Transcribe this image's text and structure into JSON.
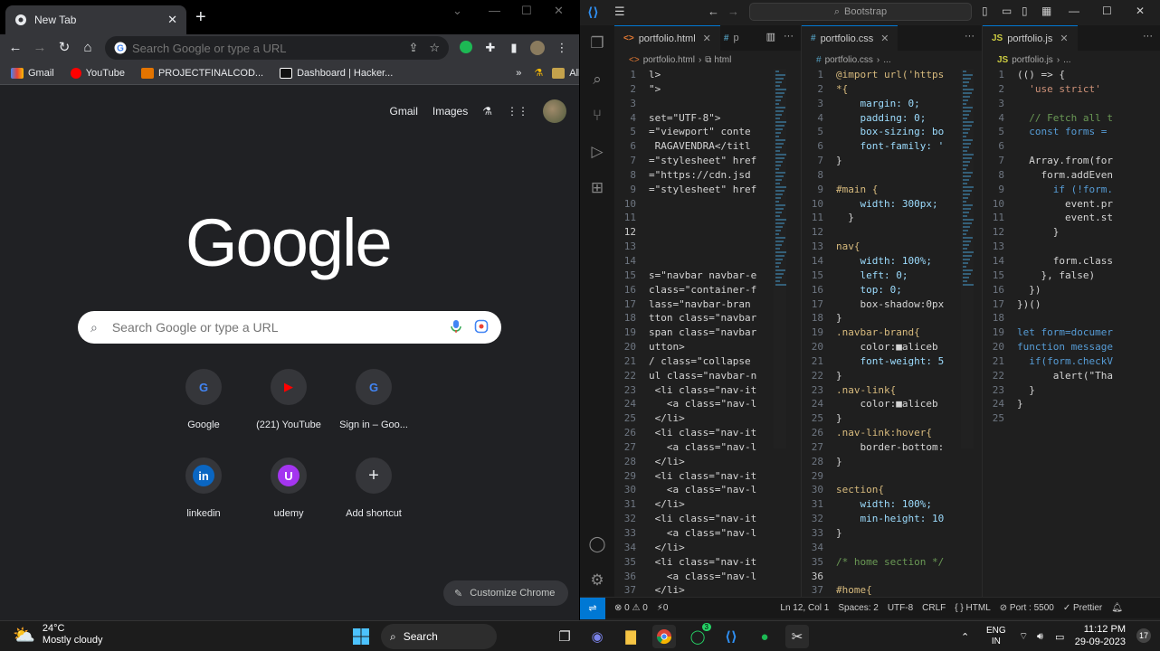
{
  "chrome": {
    "tab_title": "New Tab",
    "omnibox_placeholder": "Search Google or type a URL",
    "bookmarks": [
      {
        "label": "Gmail",
        "color": "#ea4335"
      },
      {
        "label": "YouTube",
        "color": "#ff0000"
      },
      {
        "label": "PROJECTFINALCOD...",
        "color": "#e37400"
      },
      {
        "label": "Dashboard | Hacker...",
        "color": "#ffffff"
      }
    ],
    "all_bookmarks": "All Bookmarks",
    "overflow": "»",
    "ntp": {
      "gmail": "Gmail",
      "images": "Images",
      "logo": "Google",
      "search_placeholder": "Search Google or type a URL",
      "customize": "Customize Chrome",
      "shortcuts": [
        {
          "label": "Google",
          "glyph": "G",
          "color": "#4285f4"
        },
        {
          "label": "(221) YouTube",
          "glyph": "▶",
          "color": "#ff0000"
        },
        {
          "label": "Sign in – Goo...",
          "glyph": "G",
          "color": "#4285f4"
        },
        {
          "label": "linkedin",
          "glyph": "in",
          "color": "#0a66c2"
        },
        {
          "label": "udemy",
          "glyph": "U",
          "color": "#a435f0"
        },
        {
          "label": "Add shortcut",
          "glyph": "+",
          "color": "#e8eaed"
        }
      ]
    }
  },
  "vscode": {
    "command_center": "Bootstrap",
    "groups": [
      {
        "tab": "portfolio.html",
        "tab_icon": "<>",
        "extra_tab": "p",
        "breadcrumb": [
          "portfolio.html",
          "html"
        ],
        "lines": [
          [
            "1",
            "l>"
          ],
          [
            "2",
            "\">"
          ],
          [
            "3",
            ""
          ],
          [
            "4",
            "set=\"UTF-8\">"
          ],
          [
            "5",
            "=\"viewport\" conte"
          ],
          [
            "6",
            " RAGAVENDRA</titl"
          ],
          [
            "7",
            "=\"stylesheet\" href"
          ],
          [
            "8",
            "=\"https://cdn.jsd"
          ],
          [
            "9",
            "=\"stylesheet\" href"
          ],
          [
            "10",
            ""
          ],
          [
            "11",
            ""
          ],
          [
            "12",
            ""
          ],
          [
            "13",
            ""
          ],
          [
            "14",
            ""
          ],
          [
            "15",
            "s=\"navbar navbar-e"
          ],
          [
            "16",
            "class=\"container-f"
          ],
          [
            "17",
            "lass=\"navbar-bran"
          ],
          [
            "18",
            "tton class=\"navbar"
          ],
          [
            "19",
            "span class=\"navbar"
          ],
          [
            "20",
            "utton>"
          ],
          [
            "21",
            "/ class=\"collapse"
          ],
          [
            "22",
            "ul class=\"navbar-n"
          ],
          [
            "23",
            " <li class=\"nav-it"
          ],
          [
            "24",
            "   <a class=\"nav-l"
          ],
          [
            "25",
            " </li>"
          ],
          [
            "26",
            " <li class=\"nav-it"
          ],
          [
            "27",
            "   <a class=\"nav-l"
          ],
          [
            "28",
            " </li>"
          ],
          [
            "29",
            " <li class=\"nav-it"
          ],
          [
            "30",
            "   <a class=\"nav-l"
          ],
          [
            "31",
            " </li>"
          ],
          [
            "32",
            " <li class=\"nav-it"
          ],
          [
            "33",
            "   <a class=\"nav-l"
          ],
          [
            "34",
            " </li>"
          ],
          [
            "35",
            " <li class=\"nav-it"
          ],
          [
            "36",
            "   <a class=\"nav-l"
          ],
          [
            "37",
            " </li>"
          ]
        ]
      },
      {
        "tab": "portfolio.css",
        "tab_icon": "#",
        "breadcrumb": [
          "portfolio.css",
          "..."
        ],
        "lines": [
          [
            "1",
            "@import url('https"
          ],
          [
            "2",
            "*{"
          ],
          [
            "3",
            "    margin: 0;"
          ],
          [
            "4",
            "    padding: 0;"
          ],
          [
            "5",
            "    box-sizing: bo"
          ],
          [
            "6",
            "    font-family: '"
          ],
          [
            "7",
            "}"
          ],
          [
            "8",
            ""
          ],
          [
            "9",
            "#main {"
          ],
          [
            "10",
            "    width: 300px;"
          ],
          [
            "11",
            "  }"
          ],
          [
            "12",
            ""
          ],
          [
            "13",
            "nav{"
          ],
          [
            "14",
            "    width: 100%;"
          ],
          [
            "15",
            "    left: 0;"
          ],
          [
            "16",
            "    top: 0;"
          ],
          [
            "17",
            "    box-shadow:0px"
          ],
          [
            "18",
            "}"
          ],
          [
            "19",
            ".navbar-brand{"
          ],
          [
            "20",
            "    color:■aliceb"
          ],
          [
            "21",
            "    font-weight: 5"
          ],
          [
            "22",
            "}"
          ],
          [
            "23",
            ".nav-link{"
          ],
          [
            "24",
            "    color:■aliceb"
          ],
          [
            "25",
            "}"
          ],
          [
            "26",
            ".nav-link:hover{"
          ],
          [
            "27",
            "    border-bottom:"
          ],
          [
            "28",
            "}"
          ],
          [
            "29",
            ""
          ],
          [
            "30",
            "section{"
          ],
          [
            "31",
            "    width: 100%;"
          ],
          [
            "32",
            "    min-height: 10"
          ],
          [
            "33",
            "}"
          ],
          [
            "34",
            ""
          ],
          [
            "35",
            "/* home section */"
          ],
          [
            "36",
            ""
          ],
          [
            "37",
            "#home{"
          ]
        ]
      },
      {
        "tab": "portfolio.js",
        "tab_icon": "JS",
        "breadcrumb": [
          "portfolio.js",
          "..."
        ],
        "lines": [
          [
            "1",
            "(() => {"
          ],
          [
            "2",
            "  'use strict'"
          ],
          [
            "3",
            ""
          ],
          [
            "4",
            "  // Fetch all t"
          ],
          [
            "5",
            "  const forms ="
          ],
          [
            "6",
            ""
          ],
          [
            "7",
            "  Array.from(for"
          ],
          [
            "8",
            "    form.addEven"
          ],
          [
            "9",
            "      if (!form."
          ],
          [
            "10",
            "        event.pr"
          ],
          [
            "11",
            "        event.st"
          ],
          [
            "12",
            "      }"
          ],
          [
            "13",
            ""
          ],
          [
            "14",
            "      form.class"
          ],
          [
            "15",
            "    }, false)"
          ],
          [
            "16",
            "  })"
          ],
          [
            "17",
            "})()"
          ],
          [
            "18",
            ""
          ],
          [
            "19",
            "let form=documer"
          ],
          [
            "20",
            "function message"
          ],
          [
            "21",
            "  if(form.checkV"
          ],
          [
            "22",
            "      alert(\"Tha"
          ],
          [
            "23",
            "  }"
          ],
          [
            "24",
            "}"
          ],
          [
            "25",
            ""
          ]
        ]
      }
    ],
    "status": {
      "errors": "⊗ 0 ⚠ 0",
      "ports": "⚡0",
      "position": "Ln 12, Col 1",
      "spaces": "Spaces: 2",
      "encoding": "UTF-8",
      "eol": "CRLF",
      "language": "{ } HTML",
      "port": "⊘ Port : 5500",
      "prettier": "✓ Prettier"
    }
  },
  "taskbar": {
    "temp": "24°C",
    "weather": "Mostly cloudy",
    "search": "Search",
    "lang_1": "ENG",
    "lang_2": "IN",
    "time": "11:12 PM",
    "date": "29-09-2023",
    "notifications": "17",
    "whatsapp_badge": "3"
  }
}
